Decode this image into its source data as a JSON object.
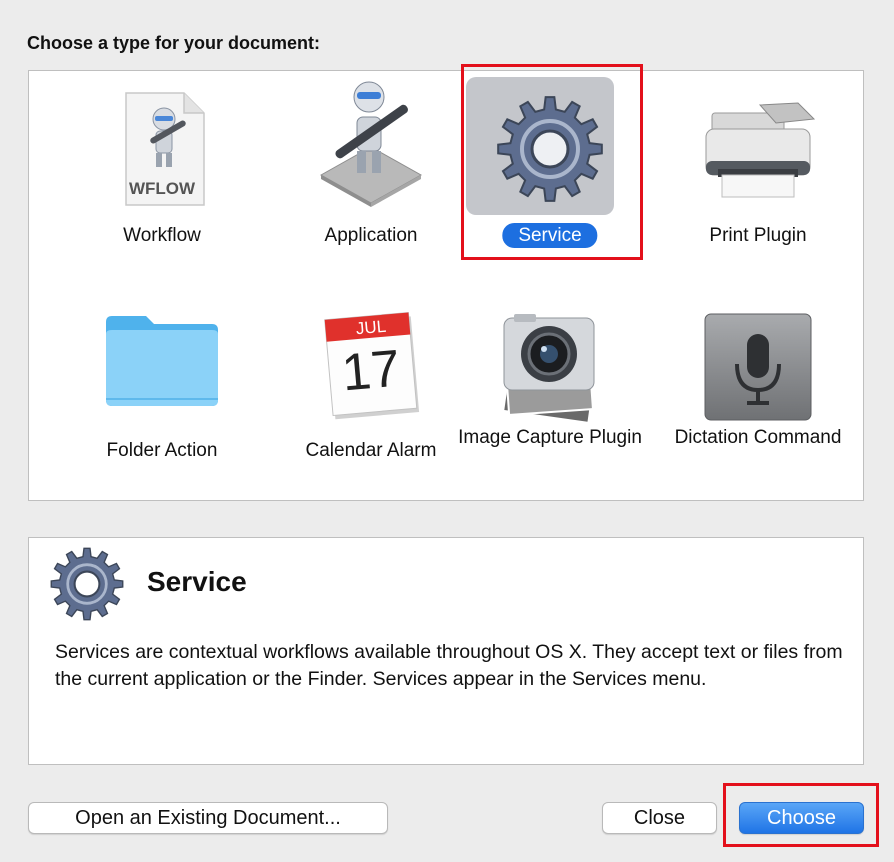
{
  "dialog": {
    "prompt": "Choose a type for your document:"
  },
  "types": [
    {
      "label": "Workflow",
      "icon": "wflow-document-icon",
      "badge": "WFLOW"
    },
    {
      "label": "Application",
      "icon": "automator-robot-icon"
    },
    {
      "label": "Service",
      "icon": "gear-icon",
      "selected": true
    },
    {
      "label": "Print Plugin",
      "icon": "printer-icon"
    },
    {
      "label": "Folder Action",
      "icon": "folder-icon"
    },
    {
      "label": "Calendar Alarm",
      "icon": "calendar-icon",
      "month": "JUL",
      "day": "17"
    },
    {
      "label": "Image Capture Plugin",
      "icon": "camera-icon"
    },
    {
      "label": "Dictation Command",
      "icon": "microphone-icon"
    }
  ],
  "description": {
    "title": "Service",
    "icon": "gear-icon",
    "text": "Services are contextual workflows available throughout OS X. They accept text or files from the current application or the Finder. Services appear in the Services menu."
  },
  "buttons": {
    "open_existing": "Open an Existing Document...",
    "close": "Close",
    "choose": "Choose"
  },
  "colors": {
    "selection": "#1d6fe0",
    "highlight_annotation": "#e3101b",
    "gear": "#5d6d8f"
  }
}
